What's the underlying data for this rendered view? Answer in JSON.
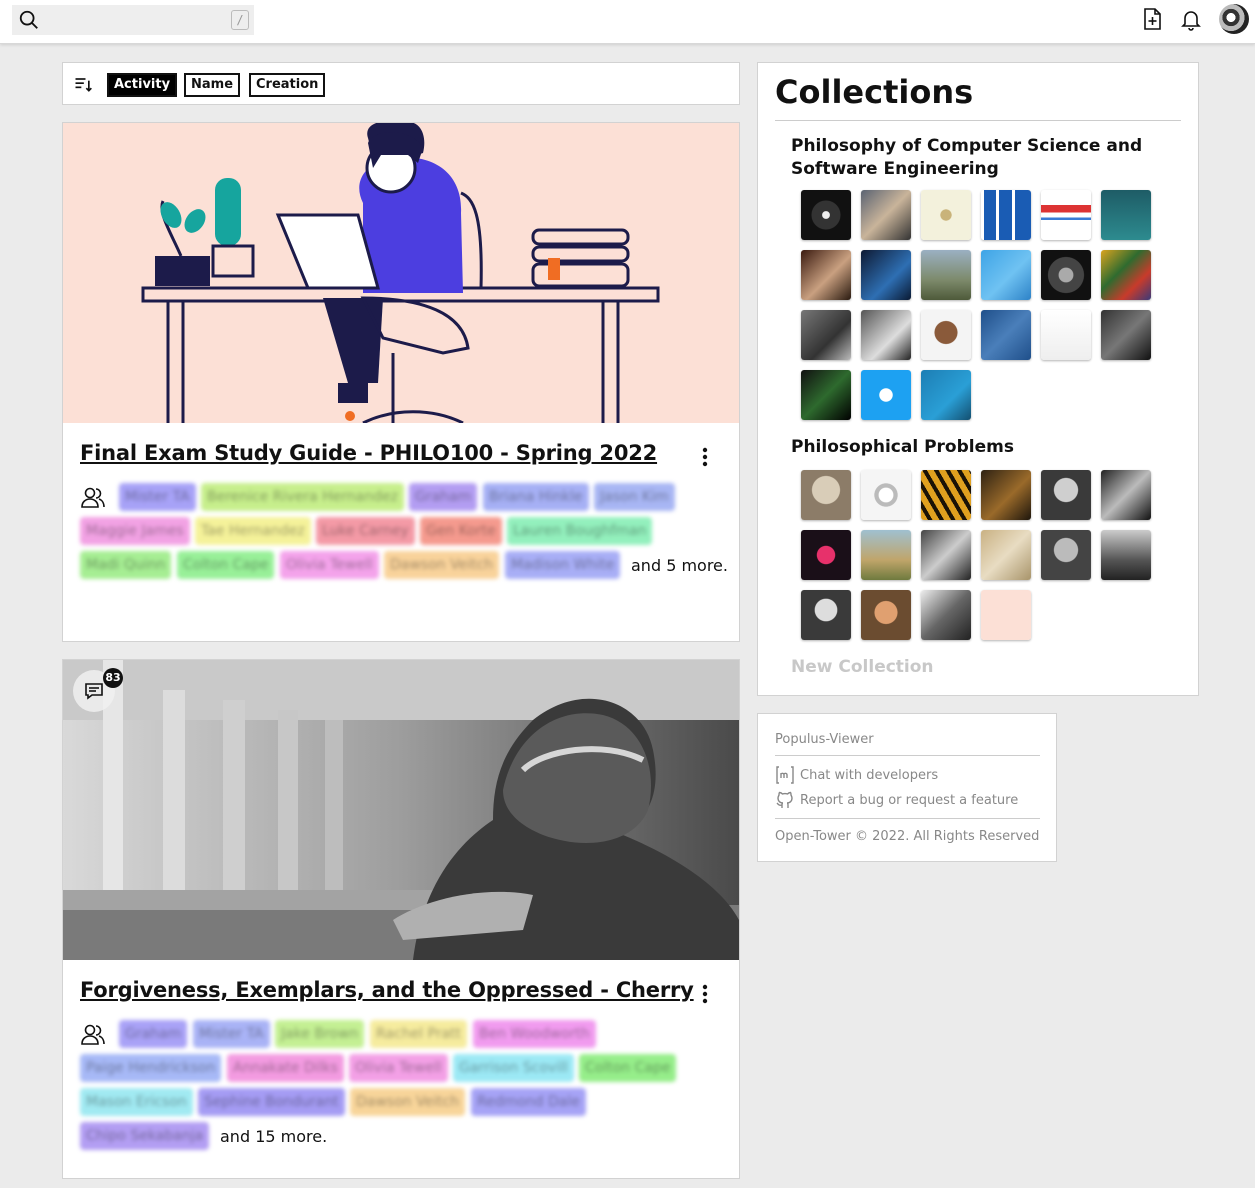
{
  "search": {
    "placeholder": "",
    "shortcut": "/"
  },
  "sort": {
    "options": [
      "Activity",
      "Name",
      "Creation"
    ],
    "active": "Activity"
  },
  "cards": [
    {
      "title": "Final Exam Study Guide - PHILO100 - Spring 2022",
      "members": [
        "Mister TA",
        "Berenice Rivera Hernandez",
        "Graham",
        "Briana Hinkle",
        "Jason Kim",
        "Maggie James",
        "Tae Hernandez",
        "Luke Carney",
        "Gen Korte",
        "Lauren Boughfman",
        "Madi Quinn",
        "Colton Cape",
        "Olivia Tewell",
        "Dawson Veitch",
        "Madison White"
      ],
      "more": "and 5 more."
    },
    {
      "title": "Forgiveness, Exemplars, and the Oppressed - Cherry",
      "comments": "83",
      "members": [
        "Graham",
        "Mister TA",
        "Jake Brown",
        "Rachel Pratt",
        "Ben Woodworth",
        "Paige Hendrickson",
        "Annakate Dilks",
        "Olivia Tewell",
        "Garrison Scovill",
        "Colton Cape",
        "Mason Ericson",
        "Sephine Bondurant",
        "Dawson Veitch",
        "Redmond Dale",
        "Chipo Sekabanja"
      ],
      "more": "and 15 more."
    }
  ],
  "collections": {
    "title": "Collections",
    "groups": [
      {
        "name": "Philosophy of Computer Science and Software Engineering",
        "count": 21
      },
      {
        "name": "Philosophical Problems",
        "count": 16
      }
    ],
    "new_label": "New Collection"
  },
  "footer": {
    "app": "Populus-Viewer",
    "chat": "Chat with developers",
    "report": "Report a bug or request a feature",
    "copyright": "Open-Tower © 2022. All Rights Reserved"
  },
  "icons": [
    "search-icon",
    "new-document-icon",
    "bell-icon",
    "sort-icon",
    "kebab-icon",
    "people-icon",
    "comment-icon",
    "matrix-icon",
    "github-icon"
  ]
}
